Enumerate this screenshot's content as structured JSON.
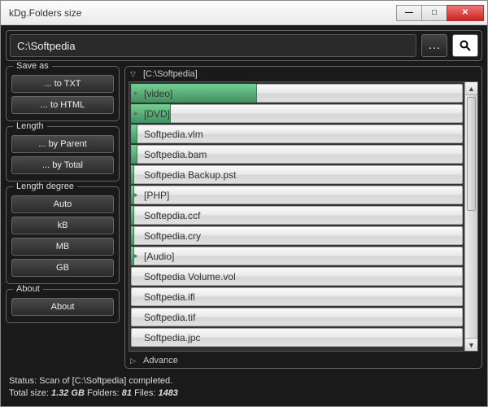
{
  "window": {
    "title": "kDg.Folders size"
  },
  "pathbar": {
    "path": "C:\\Softpedia"
  },
  "sidebar": {
    "save_as": {
      "title": "Save as",
      "to_txt": "... to TXT",
      "to_html": "... to HTML"
    },
    "length": {
      "title": "Length",
      "by_parent": "... by Parent",
      "by_total": "... by Total"
    },
    "length_degree": {
      "title": "Length degree",
      "auto": "Auto",
      "kb": "kB",
      "mb": "MB",
      "gb": "GB"
    },
    "about": {
      "title": "About",
      "about_btn": "About"
    }
  },
  "main": {
    "header": "[C:\\Softpedia]",
    "items": [
      {
        "label": "[video]",
        "folder": true,
        "bar_pct": 38
      },
      {
        "label": "[DVD]",
        "folder": true,
        "bar_pct": 12
      },
      {
        "label": "Softpedia.vlm",
        "folder": false,
        "bar_pct": 2
      },
      {
        "label": "Softpedia.bam",
        "folder": false,
        "bar_pct": 2
      },
      {
        "label": "Softpedia Backup.pst",
        "folder": false,
        "bar_pct": 1
      },
      {
        "label": "[PHP]",
        "folder": true,
        "bar_pct": 1
      },
      {
        "label": "Softepdia.ccf",
        "folder": false,
        "bar_pct": 1
      },
      {
        "label": "Softpedia.cry",
        "folder": false,
        "bar_pct": 1
      },
      {
        "label": "[Audio]",
        "folder": true,
        "bar_pct": 1
      },
      {
        "label": "Softpedia Volume.vol",
        "folder": false,
        "bar_pct": 0
      },
      {
        "label": "Softpedia.ifl",
        "folder": false,
        "bar_pct": 0
      },
      {
        "label": "Softpedia.tif",
        "folder": false,
        "bar_pct": 0
      },
      {
        "label": "Softpedia.jpc",
        "folder": false,
        "bar_pct": 0
      }
    ],
    "advance": "Advance"
  },
  "status": {
    "line1_a": "Status: Scan of [",
    "line1_b": "C:\\Softpedia",
    "line1_c": "] completed.",
    "total_prefix": "Total size: ",
    "total_size": "1.32 GB",
    "folders_prefix": "   Folders: ",
    "folders": "81",
    "files_prefix": "   Files: ",
    "files": "1483"
  }
}
